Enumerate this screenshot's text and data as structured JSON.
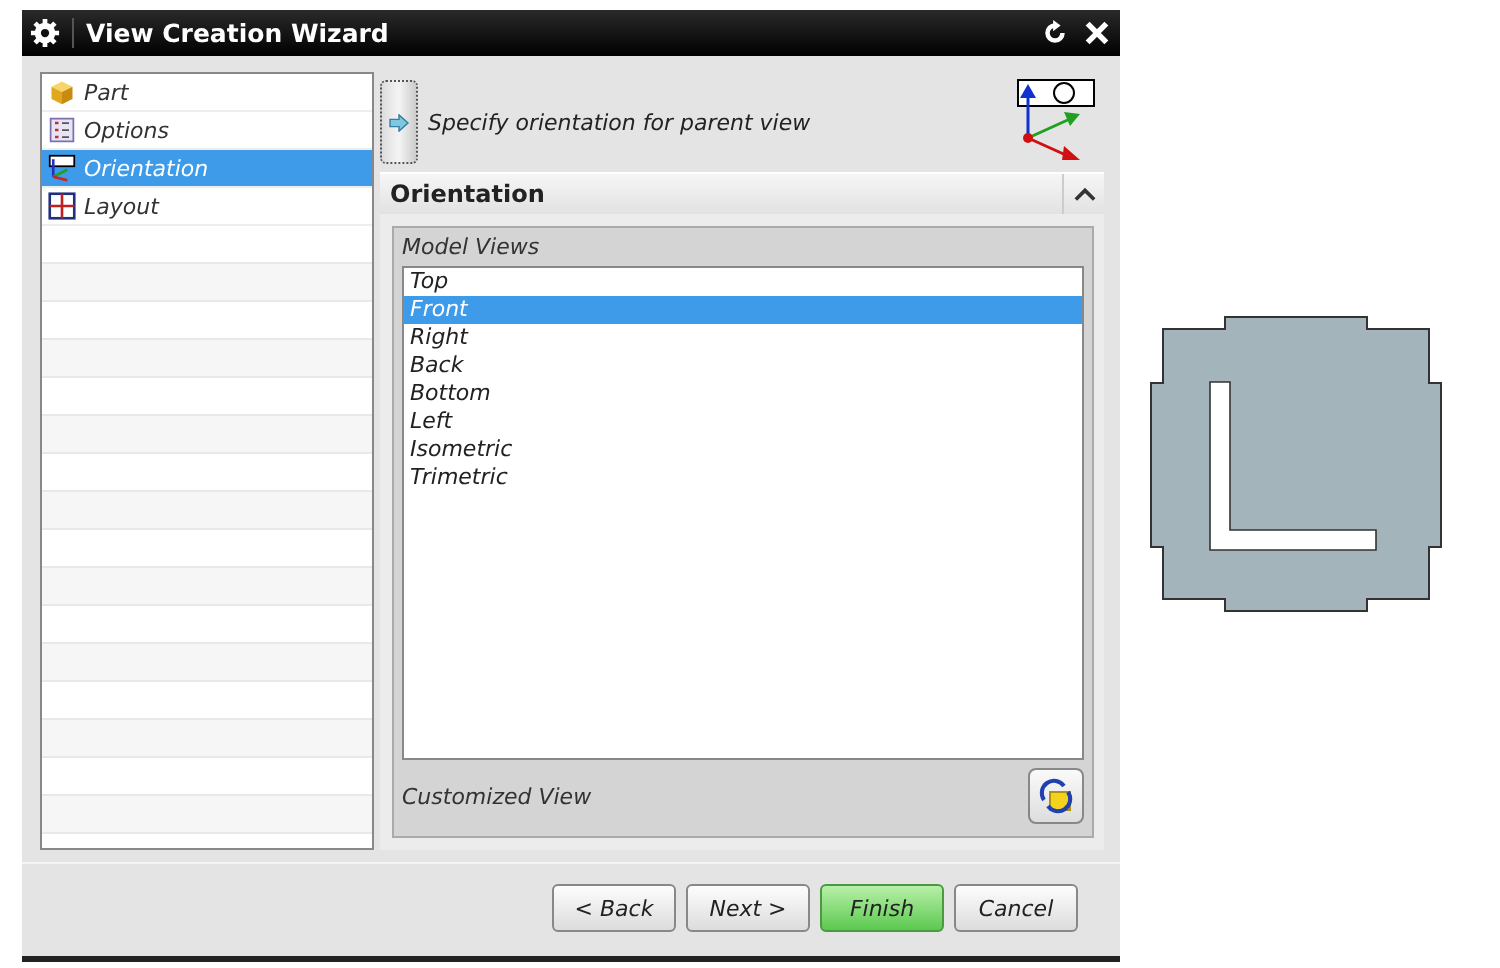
{
  "window": {
    "title": "View Creation Wizard"
  },
  "steps": [
    {
      "label": "Part",
      "kind": "part",
      "selected": false
    },
    {
      "label": "Options",
      "kind": "options",
      "selected": false
    },
    {
      "label": "Orientation",
      "kind": "orientation",
      "selected": true
    },
    {
      "label": "Layout",
      "kind": "layout",
      "selected": false
    }
  ],
  "prompt": "Specify orientation for parent view",
  "section": {
    "title": "Orientation",
    "expanded": true
  },
  "model_views": {
    "label": "Model Views",
    "items": [
      {
        "label": "Top",
        "selected": false
      },
      {
        "label": "Front",
        "selected": true
      },
      {
        "label": "Right",
        "selected": false
      },
      {
        "label": "Back",
        "selected": false
      },
      {
        "label": "Bottom",
        "selected": false
      },
      {
        "label": "Left",
        "selected": false
      },
      {
        "label": "Isometric",
        "selected": false
      },
      {
        "label": "Trimetric",
        "selected": false
      }
    ]
  },
  "customized_view": {
    "label": "Customized View"
  },
  "buttons": [
    {
      "label": "< Back",
      "kind": "default"
    },
    {
      "label": "Next >",
      "kind": "default"
    },
    {
      "label": "Finish",
      "kind": "primary"
    },
    {
      "label": "Cancel",
      "kind": "default"
    }
  ]
}
